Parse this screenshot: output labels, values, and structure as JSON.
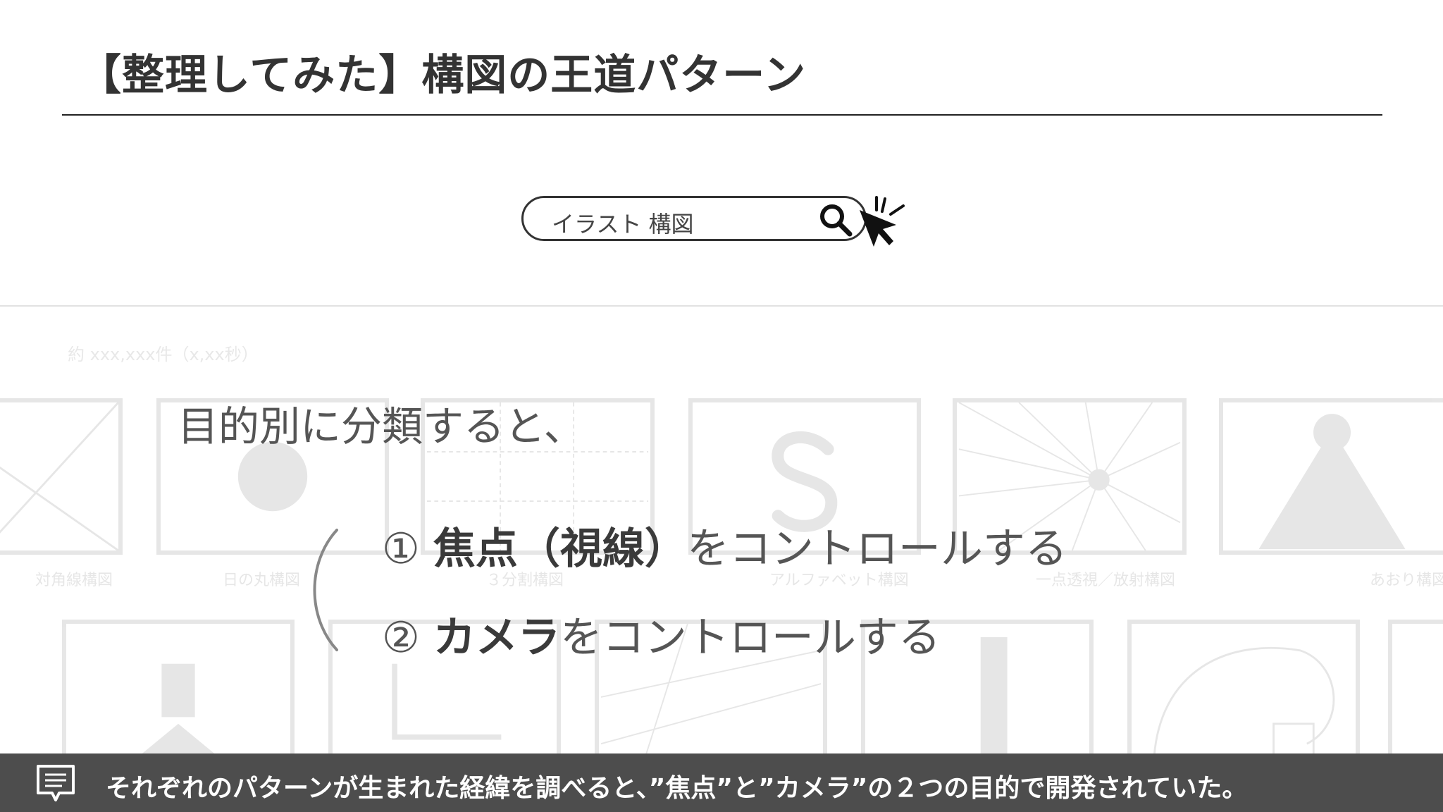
{
  "header": {
    "title": "【整理してみた】構図の王道パターン"
  },
  "search": {
    "query": "イラスト 構図"
  },
  "results": {
    "count_text": "約 xxx,xxx件（x,xx秒）",
    "thumbnails": [
      {
        "caption": "対角線構図"
      },
      {
        "caption": "日の丸構図"
      },
      {
        "caption": "３分割構図"
      },
      {
        "caption": "アルファベット構図"
      },
      {
        "caption": "一点透視／放射構図"
      },
      {
        "caption": "あおり構図"
      }
    ]
  },
  "body": {
    "intro": "目的別に分類すると、",
    "points": [
      {
        "number": "①",
        "bold": "焦点（視線）",
        "rest": "をコントロールする"
      },
      {
        "number": "②",
        "bold": "カメラ",
        "rest": "をコントロールする"
      }
    ]
  },
  "caption": {
    "text": "それぞれのパターンが生まれた経緯を調べると、”焦点”と”カメラ”の２つの目的で開発されていた。"
  }
}
